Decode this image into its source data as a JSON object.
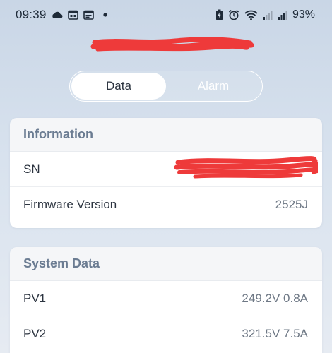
{
  "status_bar": {
    "time": "09:39",
    "battery": "93%",
    "icons_left": [
      "cloud-icon",
      "calendar-icon",
      "calendar-icon",
      "dot-icon"
    ],
    "icons_right": [
      "battery-saver-icon",
      "alarm-icon",
      "wifi-icon",
      "signal-icon",
      "signal-icon"
    ]
  },
  "header": {
    "device_name": ""
  },
  "tabs": [
    {
      "label": "Data",
      "active": true
    },
    {
      "label": "Alarm",
      "active": false
    }
  ],
  "information": {
    "title": "Information",
    "rows": [
      {
        "label": "SN",
        "value": ""
      },
      {
        "label": "Firmware Version",
        "value": "2525J"
      }
    ]
  },
  "system_data": {
    "title": "System Data",
    "rows": [
      {
        "label": "PV1",
        "value": "249.2V 0.8A"
      },
      {
        "label": "PV2",
        "value": "321.5V 7.5A"
      }
    ]
  },
  "colors": {
    "redaction": "#ee3a3a",
    "header_text": "#6b7c92",
    "value_text": "#6e7885",
    "background_top": "#c9d6e6"
  }
}
